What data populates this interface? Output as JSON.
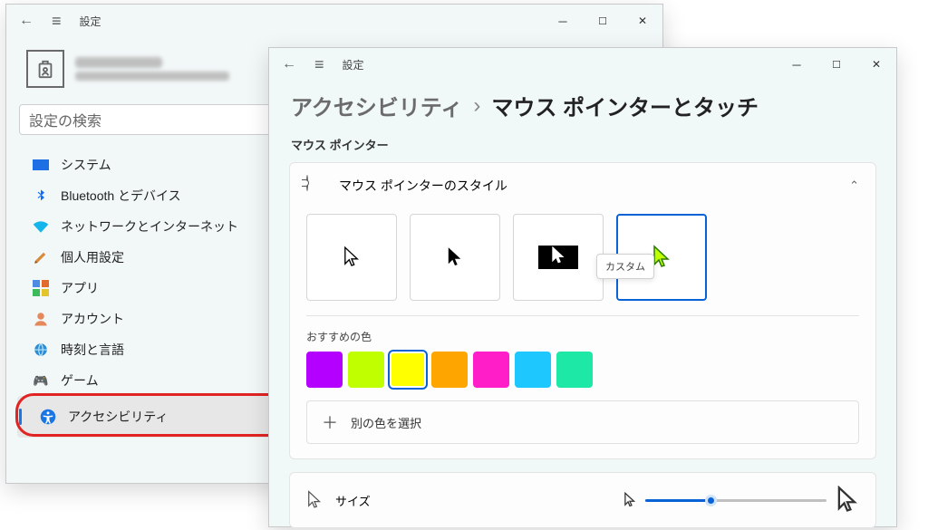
{
  "app_title": "設定",
  "search_placeholder": "設定の検索",
  "nav": {
    "items": [
      {
        "label": "システム"
      },
      {
        "label": "Bluetooth とデバイス"
      },
      {
        "label": "ネットワークとインターネット"
      },
      {
        "label": "個人用設定"
      },
      {
        "label": "アプリ"
      },
      {
        "label": "アカウント"
      },
      {
        "label": "時刻と言語"
      },
      {
        "label": "ゲーム"
      },
      {
        "label": "アクセシビリティ"
      }
    ],
    "selected_index": 8
  },
  "page": {
    "breadcrumb_parent": "アクセシビリティ",
    "breadcrumb_sep": "›",
    "breadcrumb_current": "マウス ポインターとタッチ",
    "section": "マウス ポインター",
    "style_card_title": "マウス ポインターのスタイル",
    "styles": {
      "options": [
        "white",
        "black",
        "inverted",
        "custom"
      ],
      "selected": "custom",
      "tooltip": "カスタム"
    },
    "recommended_label": "おすすめの色",
    "recommended_colors": [
      "#B400FF",
      "#BFFF00",
      "#FFFF00",
      "#FFA500",
      "#FF1EC8",
      "#1EC8FF",
      "#1EE8A5"
    ],
    "recommended_selected_index": 2,
    "other_color_label": "別の色を選択",
    "size_label": "サイズ",
    "size_value_percent": 35
  }
}
